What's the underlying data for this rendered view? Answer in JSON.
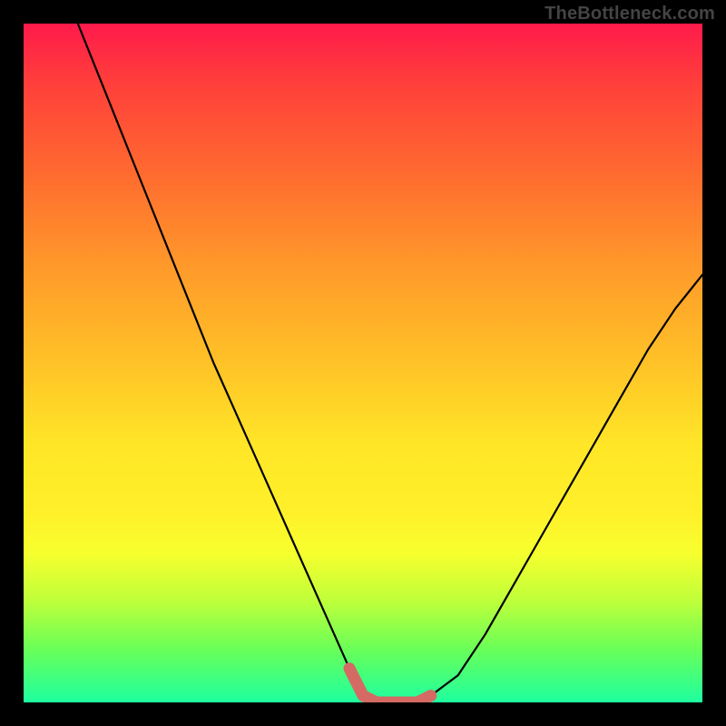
{
  "attribution": "TheBottleneck.com",
  "chart_data": {
    "type": "line",
    "title": "",
    "xlabel": "",
    "ylabel": "",
    "xlim": [
      0,
      100
    ],
    "ylim": [
      0,
      100
    ],
    "series": [
      {
        "name": "curve",
        "x": [
          8,
          12,
          16,
          20,
          24,
          28,
          32,
          36,
          40,
          44,
          48,
          50,
          52,
          54,
          56,
          58,
          60,
          64,
          68,
          72,
          76,
          80,
          84,
          88,
          92,
          96,
          100
        ],
        "values": [
          100,
          90,
          80,
          70,
          60,
          50,
          41,
          32,
          23,
          14,
          5,
          1,
          0,
          0,
          0,
          0,
          1,
          4,
          10,
          17,
          24,
          31,
          38,
          45,
          52,
          58,
          63
        ]
      }
    ],
    "annotations": {
      "highlight_segment": {
        "x_start": 48,
        "x_end": 60,
        "y_approx": 0
      }
    }
  },
  "colors": {
    "curve": "#000000",
    "highlight": "#d46a63",
    "background_top": "#ff1a4b",
    "background_bottom": "#1effa0"
  }
}
